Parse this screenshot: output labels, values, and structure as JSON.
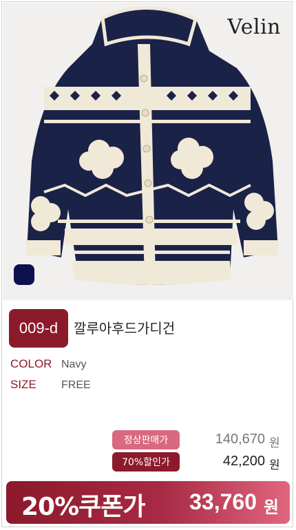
{
  "brand": "Velin",
  "product": {
    "code": "009-d",
    "name": "깔루아후드가디건",
    "color_swatch": "#0d1150"
  },
  "specs": [
    {
      "label": "COLOR",
      "value": "Navy"
    },
    {
      "label": "SIZE",
      "value": "FREE"
    }
  ],
  "prices": {
    "regular_label": "정상판매가",
    "regular_value": "140,670",
    "discount_label": "70%할인가",
    "discount_value": "42,200",
    "currency": "원"
  },
  "coupon": {
    "label": "20%쿠폰가",
    "value": "33,760",
    "currency": "원"
  },
  "colors": {
    "accent": "#8b1a2b",
    "regular_tag": "#d9697f",
    "navy": "#0d1150"
  }
}
